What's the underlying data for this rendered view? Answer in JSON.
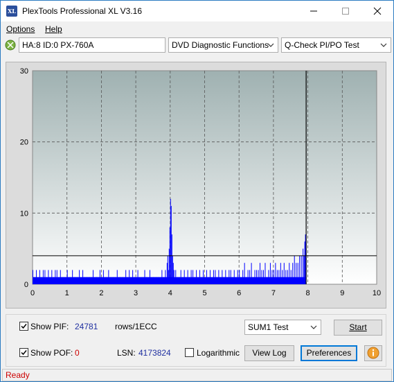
{
  "window": {
    "title": "PlexTools Professional XL V3.16",
    "logo_text": "XL",
    "min_icon": "minimize-icon",
    "max_icon": "maximize-icon",
    "close_icon": "close-icon"
  },
  "menu": {
    "options": "Options",
    "help": "Help"
  },
  "toolbar": {
    "drive": "HA:8 ID:0  PX-760A",
    "function": "DVD Diagnostic Functions",
    "test": "Q-Check PI/PO Test"
  },
  "chart_data": {
    "type": "bar",
    "x_ticks": [
      "0",
      "1",
      "2",
      "3",
      "4",
      "5",
      "6",
      "7",
      "8",
      "9",
      "10"
    ],
    "y_ticks": [
      "0",
      "10",
      "20",
      "30"
    ],
    "xlim": [
      0,
      10
    ],
    "ylim": [
      0,
      30
    ],
    "grid": true,
    "threshold_line": 4,
    "end_marker_x": 7.95,
    "colors": {
      "bars": "#0000ff",
      "plot_bg_top": "#9fb1b1",
      "plot_bg_bottom": "#ffffff"
    },
    "x": [
      0.0,
      0.05,
      0.1,
      0.15,
      0.2,
      0.25,
      0.3,
      0.35,
      0.4,
      0.45,
      0.5,
      0.55,
      0.6,
      0.65,
      0.7,
      0.75,
      0.8,
      0.85,
      0.9,
      0.95,
      1.0,
      1.05,
      1.1,
      1.15,
      1.2,
      1.25,
      1.3,
      1.35,
      1.4,
      1.45,
      1.5,
      1.55,
      1.6,
      1.65,
      1.7,
      1.75,
      1.8,
      1.85,
      1.9,
      1.95,
      2.0,
      2.05,
      2.1,
      2.15,
      2.2,
      2.25,
      2.3,
      2.35,
      2.4,
      2.45,
      2.5,
      2.55,
      2.6,
      2.65,
      2.7,
      2.75,
      2.8,
      2.85,
      2.9,
      2.95,
      3.0,
      3.05,
      3.1,
      3.15,
      3.2,
      3.25,
      3.3,
      3.35,
      3.4,
      3.45,
      3.5,
      3.55,
      3.6,
      3.65,
      3.7,
      3.75,
      3.8,
      3.85,
      3.9,
      3.92,
      3.94,
      3.96,
      3.98,
      4.0,
      4.02,
      4.04,
      4.06,
      4.08,
      4.1,
      4.15,
      4.2,
      4.25,
      4.3,
      4.35,
      4.4,
      4.45,
      4.5,
      4.55,
      4.6,
      4.65,
      4.7,
      4.75,
      4.8,
      4.85,
      4.9,
      4.95,
      5.0,
      5.05,
      5.1,
      5.15,
      5.2,
      5.25,
      5.3,
      5.35,
      5.4,
      5.45,
      5.5,
      5.55,
      5.6,
      5.65,
      5.7,
      5.75,
      5.8,
      5.85,
      5.9,
      5.95,
      6.0,
      6.05,
      6.1,
      6.15,
      6.2,
      6.25,
      6.3,
      6.35,
      6.4,
      6.45,
      6.5,
      6.55,
      6.6,
      6.65,
      6.7,
      6.75,
      6.8,
      6.85,
      6.9,
      6.95,
      7.0,
      7.05,
      7.1,
      7.15,
      7.2,
      7.25,
      7.3,
      7.35,
      7.4,
      7.45,
      7.5,
      7.55,
      7.6,
      7.65,
      7.7,
      7.75,
      7.8,
      7.85,
      7.88,
      7.9,
      7.92,
      7.94
    ],
    "values": [
      2,
      1,
      2,
      1,
      2,
      1,
      2,
      2,
      1,
      2,
      1,
      2,
      1,
      2,
      2,
      1,
      2,
      1,
      1,
      1,
      2,
      1,
      1,
      2,
      1,
      1,
      1,
      2,
      1,
      2,
      1,
      1,
      1,
      1,
      1,
      2,
      1,
      1,
      1,
      2,
      1,
      2,
      1,
      1,
      2,
      1,
      1,
      1,
      1,
      2,
      1,
      1,
      1,
      1,
      2,
      1,
      2,
      1,
      2,
      1,
      1,
      2,
      1,
      1,
      1,
      2,
      1,
      1,
      2,
      1,
      1,
      1,
      1,
      1,
      1,
      2,
      1,
      2,
      3,
      4,
      2,
      5,
      8,
      12,
      11,
      7,
      4,
      3,
      2,
      2,
      1,
      1,
      2,
      1,
      2,
      1,
      2,
      1,
      2,
      2,
      1,
      2,
      1,
      2,
      1,
      2,
      1,
      2,
      1,
      2,
      1,
      2,
      2,
      1,
      2,
      1,
      2,
      1,
      2,
      1,
      2,
      2,
      1,
      2,
      1,
      2,
      2,
      1,
      2,
      3,
      1,
      2,
      2,
      3,
      1,
      2,
      2,
      2,
      3,
      2,
      2,
      3,
      1,
      2,
      3,
      2,
      2,
      3,
      2,
      2,
      3,
      2,
      3,
      2,
      2,
      3,
      2,
      3,
      4,
      3,
      3,
      4,
      4,
      5,
      4,
      6,
      7
    ]
  },
  "bottom": {
    "show_pif_label": "Show PIF:",
    "pif_value": "24781",
    "pif_unit": "rows/1ECC",
    "show_pof_label": "Show POF:",
    "pof_value": "0",
    "lsn_label": "LSN:",
    "lsn_value": "4173824",
    "logarithmic_label": "Logarithmic",
    "test_select": "SUM1 Test",
    "start_label": "Start",
    "view_log_label": "View Log",
    "preferences_label": "Preferences",
    "info_icon": "info-icon",
    "value_color": "#1f2fa0",
    "pof_color": "#cc0000"
  },
  "status": {
    "text": "Ready"
  }
}
